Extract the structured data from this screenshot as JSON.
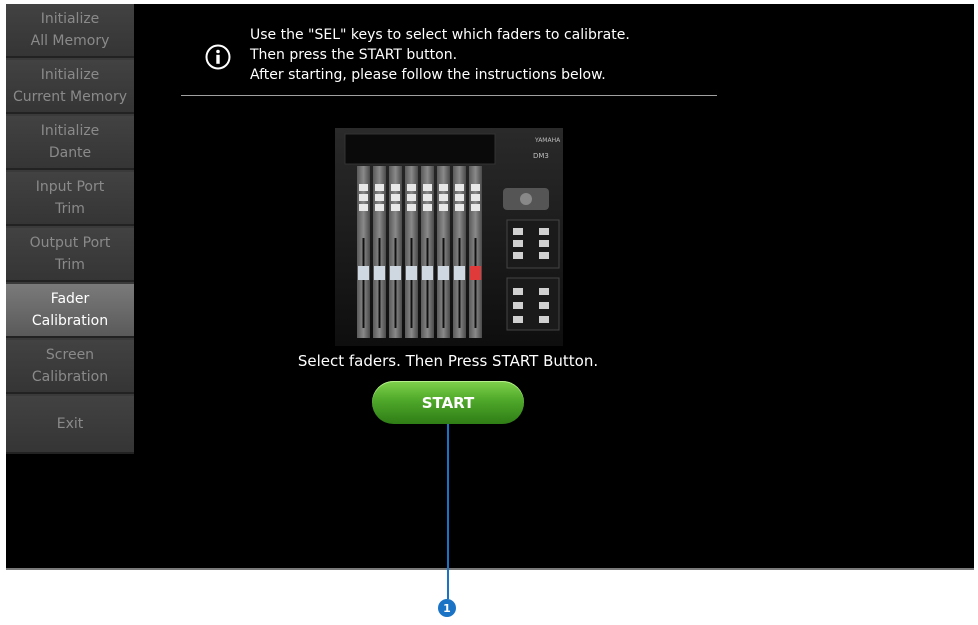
{
  "sidebar": {
    "items": [
      {
        "label": "Initialize\nAll Memory",
        "active": false
      },
      {
        "label": "Initialize\nCurrent Memory",
        "active": false
      },
      {
        "label": "Initialize\nDante",
        "active": false
      },
      {
        "label": "Input Port\nTrim",
        "active": false
      },
      {
        "label": "Output Port\nTrim",
        "active": false
      },
      {
        "label": "Fader\nCalibration",
        "active": true
      },
      {
        "label": "Screen\nCalibration",
        "active": false
      },
      {
        "label": "Exit",
        "active": false
      }
    ]
  },
  "header": {
    "info_text": "Use the \"SEL\" keys to select which faders to calibrate.\nThen press the START button.\nAfter starting, please follow the instructions below.",
    "icon": "info-icon"
  },
  "console_image": {
    "brand": "YAMAHA",
    "model": "DM3"
  },
  "main": {
    "instruction": "Select faders. Then Press START Button.",
    "start_label": "START"
  },
  "callout": {
    "number": "1"
  },
  "colors": {
    "screen_bg": "#000000",
    "start_button": "#4fa82a",
    "callout": "#1a73c4",
    "active_tab": "#6a6a6a"
  }
}
